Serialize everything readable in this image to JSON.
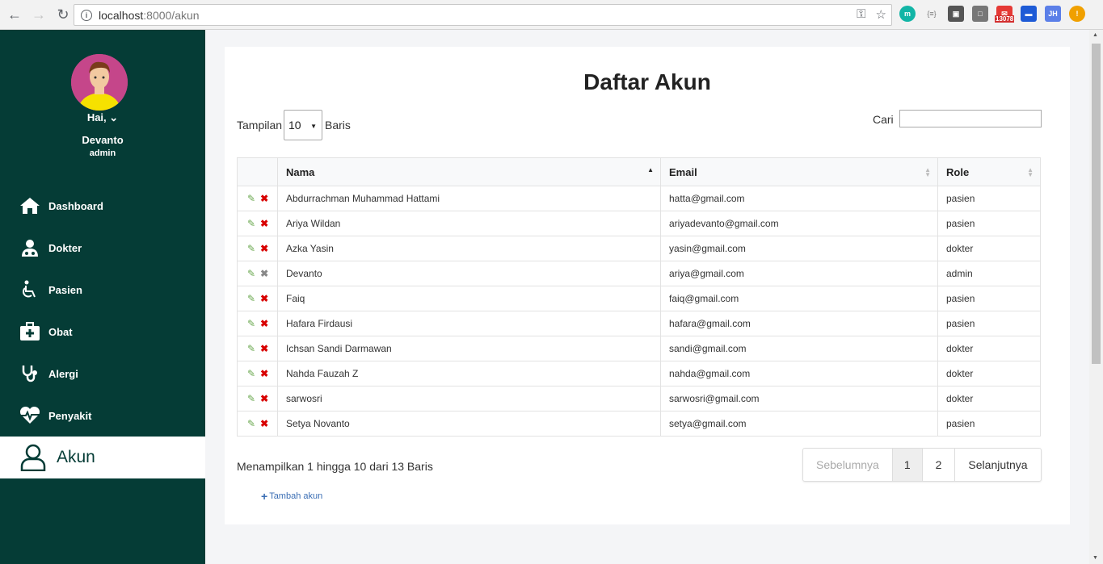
{
  "browser": {
    "url_host": "localhost",
    "url_path": ":8000/akun",
    "ext_badge": "13078",
    "ext_jh": "JH",
    "ext_m": "m",
    "ext_json": "{≡}",
    "ext_warn": "!"
  },
  "sidebar": {
    "greeting": "Hai, ⌄",
    "user_name": "Devanto",
    "user_role": "admin",
    "items": [
      {
        "label": "Dashboard",
        "icon": "home-icon"
      },
      {
        "label": "Dokter",
        "icon": "doctor-icon"
      },
      {
        "label": "Pasien",
        "icon": "wheelchair-icon"
      },
      {
        "label": "Obat",
        "icon": "medkit-icon"
      },
      {
        "label": "Alergi",
        "icon": "stethoscope-icon"
      },
      {
        "label": "Penyakit",
        "icon": "heartbeat-icon"
      },
      {
        "label": "Akun",
        "icon": "user-icon"
      }
    ],
    "active_index": 6,
    "bg_color": "#053c36"
  },
  "main": {
    "title": "Daftar Akun",
    "length_prefix": "Tampilan",
    "length_value": "10",
    "length_suffix": "Baris",
    "search_label": "Cari",
    "search_value": "",
    "columns": [
      "",
      "Nama",
      "Email",
      "Role"
    ],
    "rows": [
      {
        "name": "Abdurrachman Muhammad Hattami",
        "email": "hatta@gmail.com",
        "role": "pasien"
      },
      {
        "name": "Ariya Wildan",
        "email": "ariyadevanto@gmail.com",
        "role": "pasien"
      },
      {
        "name": "Azka Yasin",
        "email": "yasin@gmail.com",
        "role": "dokter"
      },
      {
        "name": "Devanto",
        "email": "ariya@gmail.com",
        "role": "admin"
      },
      {
        "name": "Faiq",
        "email": "faiq@gmail.com",
        "role": "pasien"
      },
      {
        "name": "Hafara Firdausi",
        "email": "hafara@gmail.com",
        "role": "pasien"
      },
      {
        "name": "Ichsan Sandi Darmawan",
        "email": "sandi@gmail.com",
        "role": "dokter"
      },
      {
        "name": "Nahda Fauzah Z",
        "email": "nahda@gmail.com",
        "role": "dokter"
      },
      {
        "name": "sarwosri",
        "email": "sarwosri@gmail.com",
        "role": "dokter"
      },
      {
        "name": "Setya Novanto",
        "email": "setya@gmail.com",
        "role": "pasien"
      }
    ],
    "info": "Menampilkan 1 hingga 10 dari 13 Baris",
    "pager": {
      "prev": "Sebelumnya",
      "pages": [
        "1",
        "2"
      ],
      "next": "Selanjutnya",
      "current": "1"
    },
    "add_label": "Tambah akun"
  }
}
